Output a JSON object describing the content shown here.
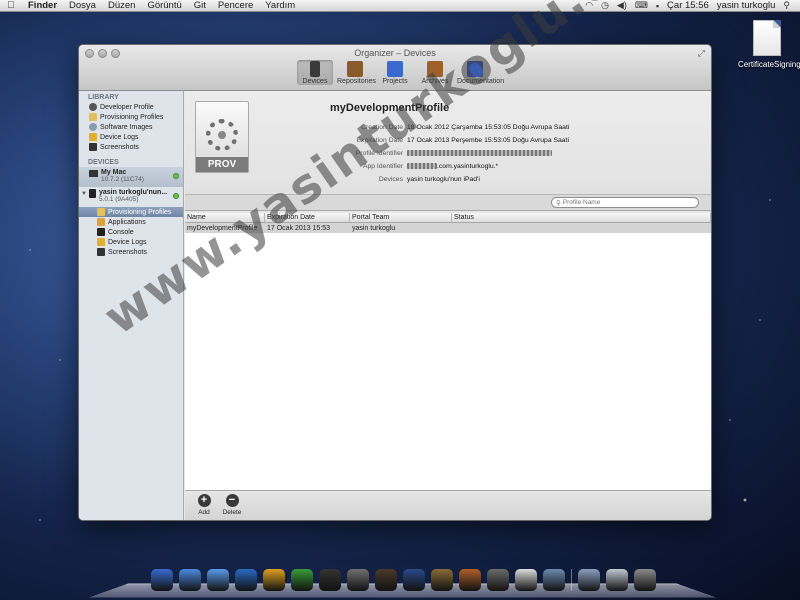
{
  "menubar": {
    "app": "Finder",
    "items": [
      "Dosya",
      "Düzen",
      "Görüntü",
      "Git",
      "Pencere",
      "Yardım"
    ],
    "clock": "Çar 15:56",
    "user": "yasin turkoglu"
  },
  "desktop": {
    "file_label": "CertificateSigningR...quest"
  },
  "window": {
    "title": "Organizer – Devices",
    "toolbar": [
      {
        "label": "Devices",
        "color": "#3a3a3a"
      },
      {
        "label": "Repositories",
        "color": "#8a5a2a"
      },
      {
        "label": "Projects",
        "color": "#3a6ad0"
      },
      {
        "label": "Archives",
        "color": "#a0602a"
      },
      {
        "label": "Documentation",
        "color": "#3a5ab0"
      }
    ]
  },
  "sidebar": {
    "library_header": "LIBRARY",
    "library": [
      "Developer Profile",
      "Provisioning Profiles",
      "Software Images",
      "Device Logs",
      "Screenshots"
    ],
    "devices_header": "DEVICES",
    "mymac": {
      "name": "My Mac",
      "version": "10.7.2 (11C74)"
    },
    "ipad": {
      "name": "yasin turkoglu'nun...",
      "version": "5.0.1 (9A405)"
    },
    "ipad_children": [
      "Provisioning Profiles",
      "Applications",
      "Console",
      "Device Logs",
      "Screenshots"
    ]
  },
  "detail": {
    "icon_label": "PROV",
    "name": "myDevelopmentProfile",
    "fields": [
      {
        "k": "Creation Date",
        "v": "18 Ocak 2012 Çarşamba 15:53:05 Doğu Avrupa Saati"
      },
      {
        "k": "Expiration Date",
        "v": "17 Ocak 2013 Perşembe 15:53:05 Doğu Avrupa Saati"
      },
      {
        "k": "Profile Identifier",
        "v": ""
      },
      {
        "k": "App Identifier",
        "v": ".com.yasinturkoglu.*"
      },
      {
        "k": "Devices",
        "v": "yasin turkoglu'nun iPad'i"
      }
    ]
  },
  "search": {
    "placeholder": "Profile Name"
  },
  "table": {
    "columns": [
      "Name",
      "Expiration Date",
      "Portal Team",
      "Status"
    ],
    "rows": [
      [
        "myDevelopmentProfile",
        "17 Ocak 2013 15:53",
        "yasin turkoglu",
        ""
      ]
    ]
  },
  "bottom": {
    "add": "Add",
    "delete": "Delete",
    "add_glyph": "+",
    "delete_glyph": "−"
  },
  "watermark": "www.yasinturkoglu.com",
  "dock": [
    "#3a6ad0",
    "#4a8ae0",
    "#5a9ae8",
    "#2a6ac0",
    "#e0a020",
    "#3a9a3a",
    "#333",
    "#707070",
    "#4a3a2a",
    "#2a4a8a",
    "#8a6a3a",
    "#b0602a",
    "#6a6a6a",
    "#ddd",
    "#6a8ab0",
    "#8aa0c0",
    "#c0c8d0",
    "#8a8a8a"
  ]
}
